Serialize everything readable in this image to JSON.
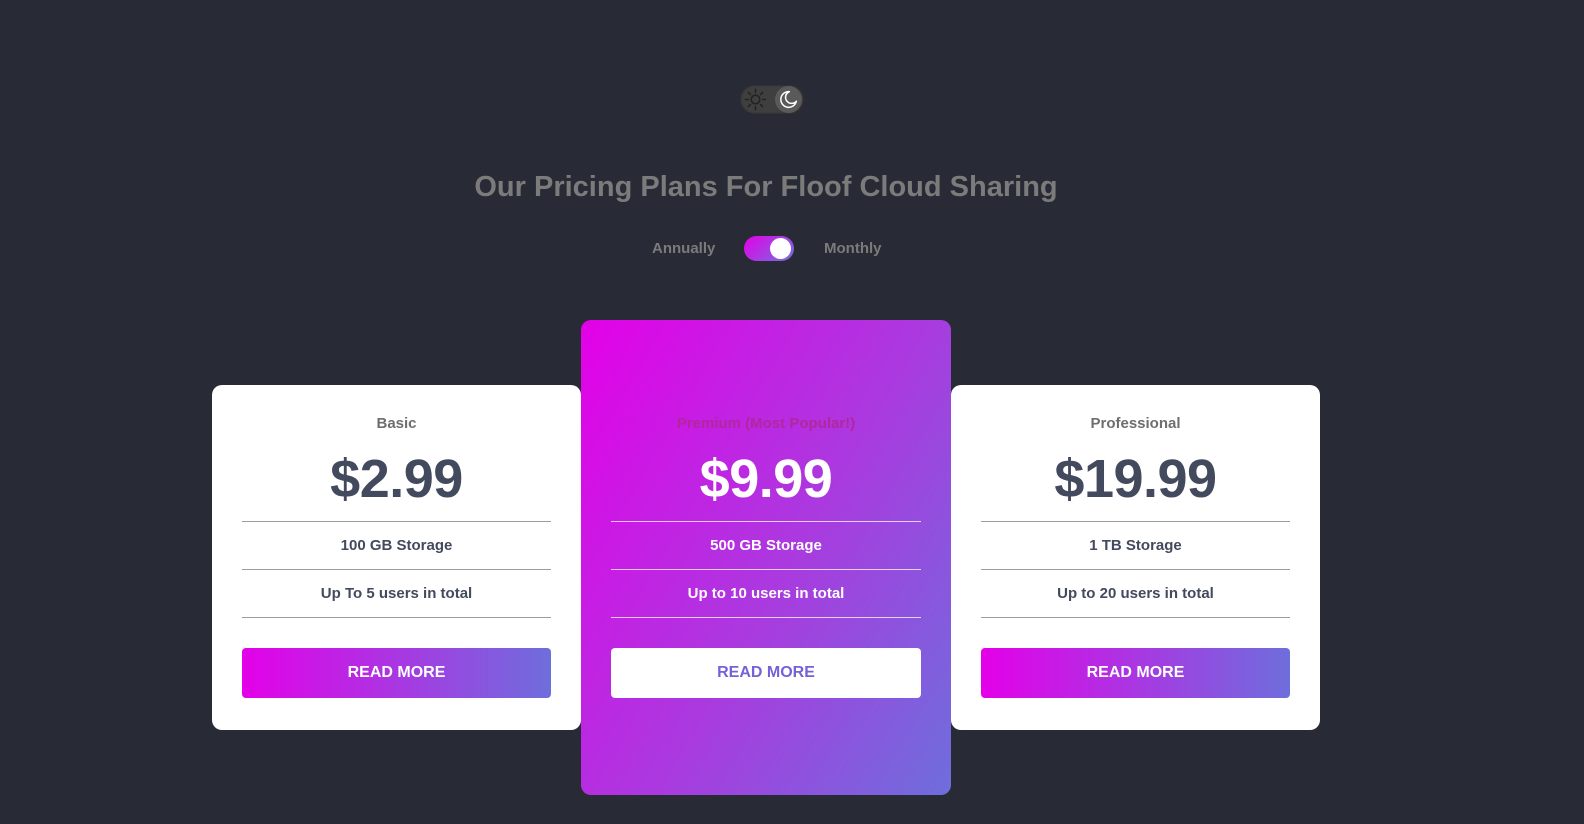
{
  "theme": {
    "light_icon": "sun-icon",
    "dark_icon": "moon-icon",
    "active": "dark"
  },
  "header": {
    "title": "Our Pricing Plans For Floof Cloud Sharing"
  },
  "billing": {
    "annual_label": "Annually",
    "monthly_label": "Monthly",
    "selected": "Monthly"
  },
  "plans": [
    {
      "name": "Basic",
      "price": "$2.99",
      "features": [
        "100 GB Storage",
        "Up To 5 users in total"
      ],
      "button_label": "READ MORE"
    },
    {
      "name": "Premium (Most Popular!)",
      "price": "$9.99",
      "features": [
        "500 GB Storage",
        "Up to 10 users in total"
      ],
      "button_label": "READ MORE"
    },
    {
      "name": "Professional",
      "price": "$19.99",
      "features": [
        "1 TB Storage",
        "Up to 20 users in total"
      ],
      "button_label": "READ MORE"
    }
  ],
  "colors": {
    "background": "#282b35",
    "accent_start": "#e400e8",
    "accent_end": "#6e6edc",
    "card": "#ffffff",
    "text_dark": "#444a5e",
    "text_muted": "#7b7b7b"
  }
}
